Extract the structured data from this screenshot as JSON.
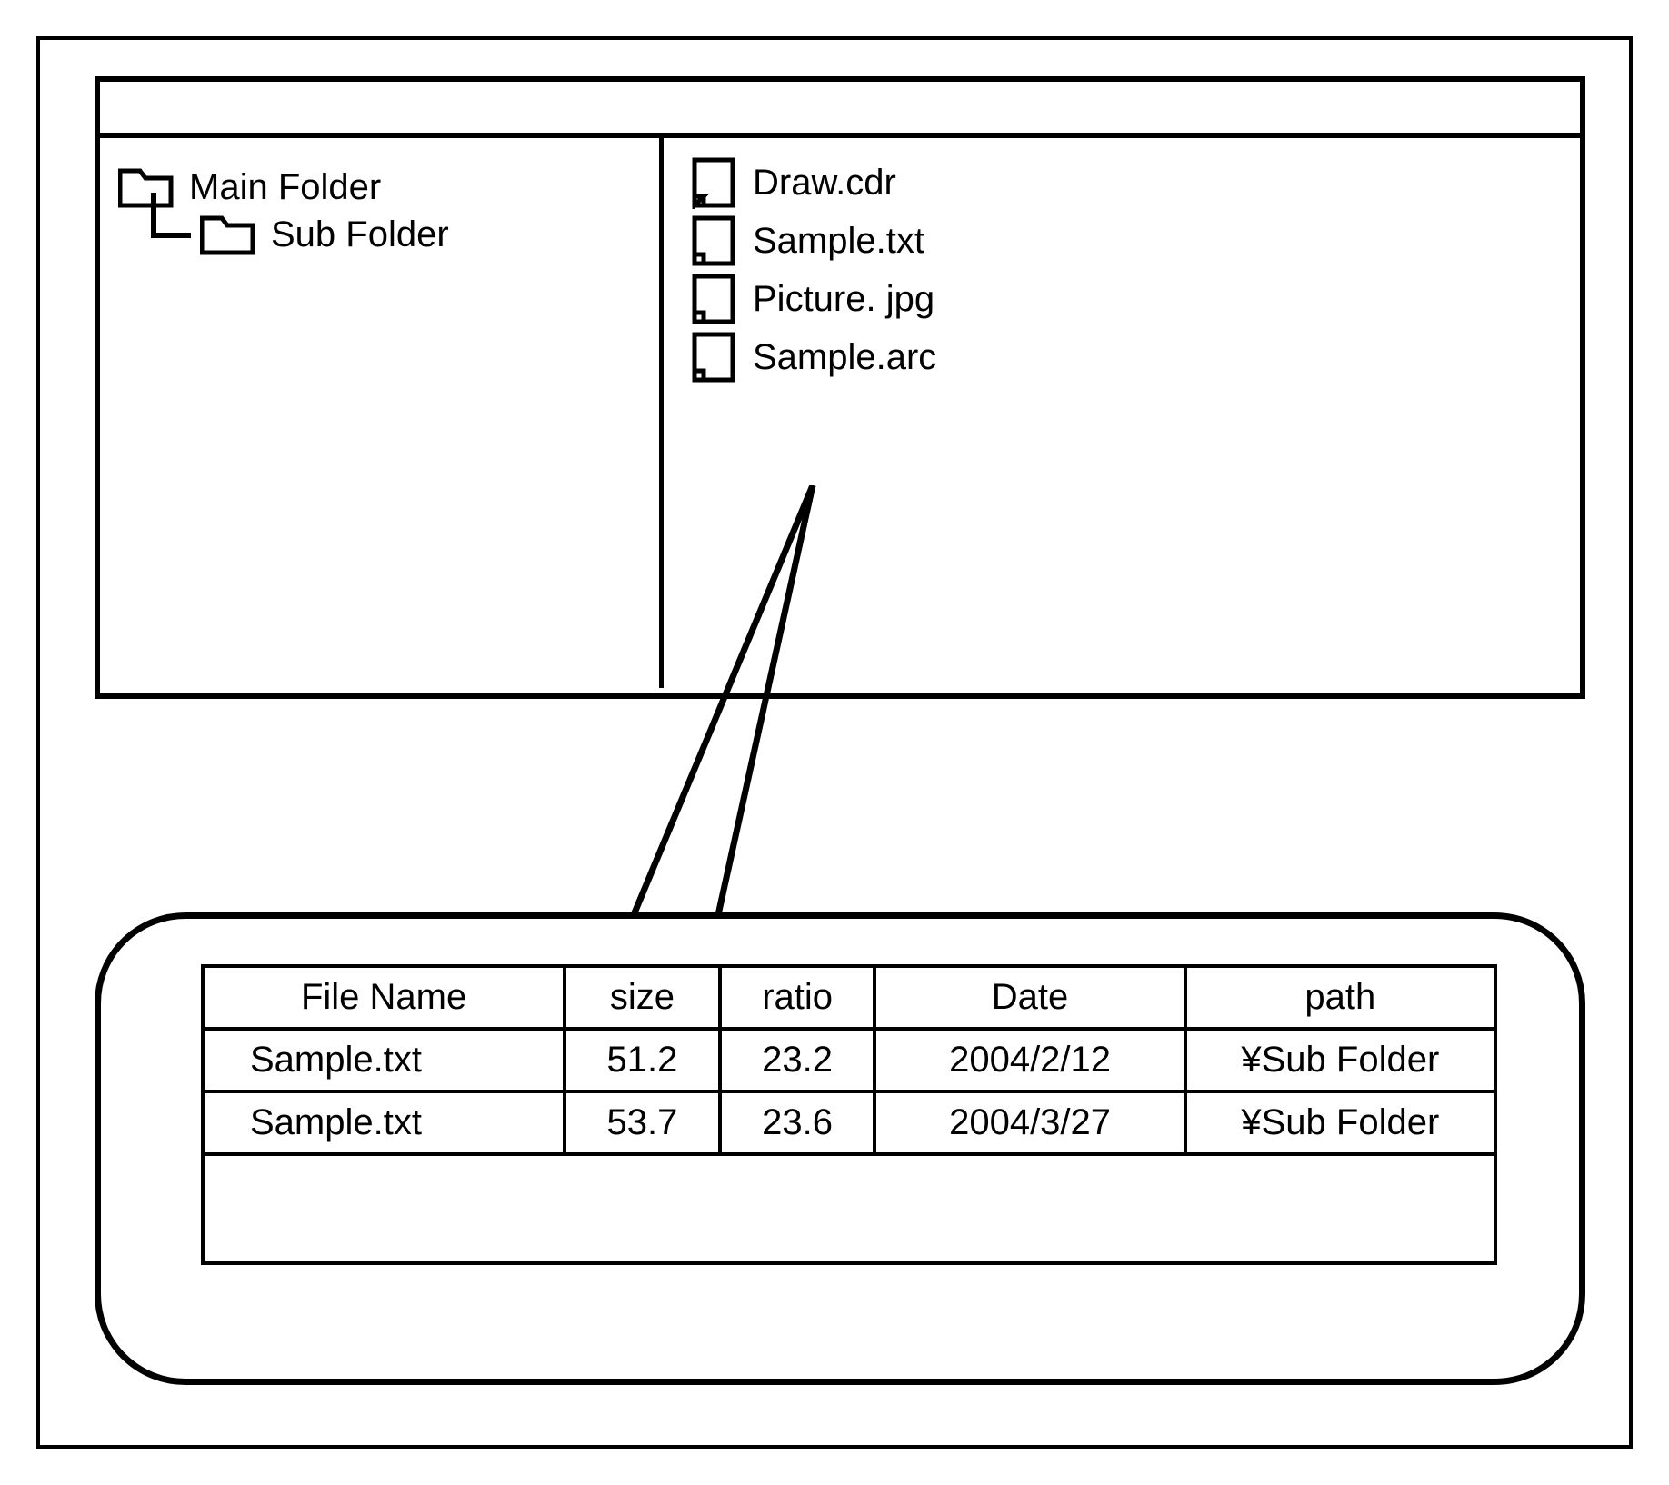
{
  "tree": {
    "root_label": "Main Folder",
    "child_label": "Sub Folder"
  },
  "files": [
    {
      "name": "Draw.cdr"
    },
    {
      "name": "Sample.txt"
    },
    {
      "name": "Picture. jpg"
    },
    {
      "name": "Sample.arc"
    }
  ],
  "table": {
    "headers": {
      "filename": "File Name",
      "size": "size",
      "ratio": "ratio",
      "date": "Date",
      "path": "path"
    },
    "rows": [
      {
        "filename": "Sample.txt",
        "size": "51.2",
        "ratio": "23.2",
        "date": "2004/2/12",
        "path": "¥Sub Folder"
      },
      {
        "filename": "Sample.txt",
        "size": "53.7",
        "ratio": "23.6",
        "date": "2004/3/27",
        "path": "¥Sub Folder"
      }
    ]
  }
}
